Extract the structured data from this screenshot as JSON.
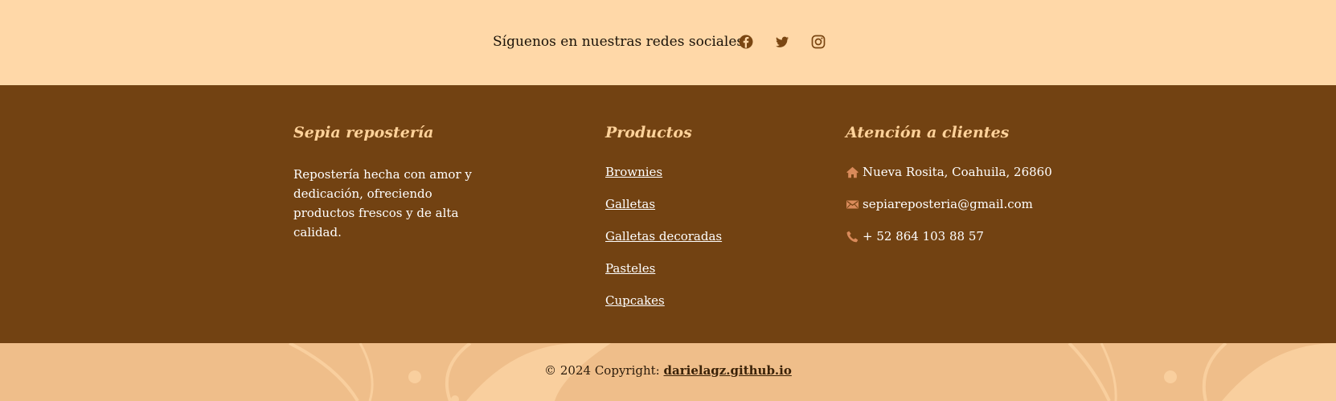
{
  "social": {
    "label": "Síguenos en nuestras redes sociales:",
    "icons": [
      "facebook-icon",
      "twitter-icon",
      "instagram-icon"
    ]
  },
  "footer": {
    "brand": {
      "title": "Sepia repostería",
      "description": "Repostería hecha con amor y dedicación, ofreciendo productos frescos y de alta calidad."
    },
    "products": {
      "title": "Productos",
      "items": [
        "Brownies",
        "Galletas",
        "Galletas decoradas",
        "Pasteles",
        "Cupcakes"
      ]
    },
    "contact": {
      "title": "Atención a clientes",
      "address": "Nueva Rosita, Coahuila, 26860",
      "email": "sepiareposteria@gmail.com",
      "phone": "+ 52 864 103 88 57"
    }
  },
  "bottom": {
    "copyright_prefix": "© 2024 Copyright:",
    "copyright_link": "darielagz.github.io"
  },
  "colors": {
    "light_bg": "#ffd8a8",
    "footer_bg": "#724212",
    "heading": "#ffd29a",
    "bottom_bg": "#efbe8a",
    "contact_icon": "#d98a5a"
  }
}
